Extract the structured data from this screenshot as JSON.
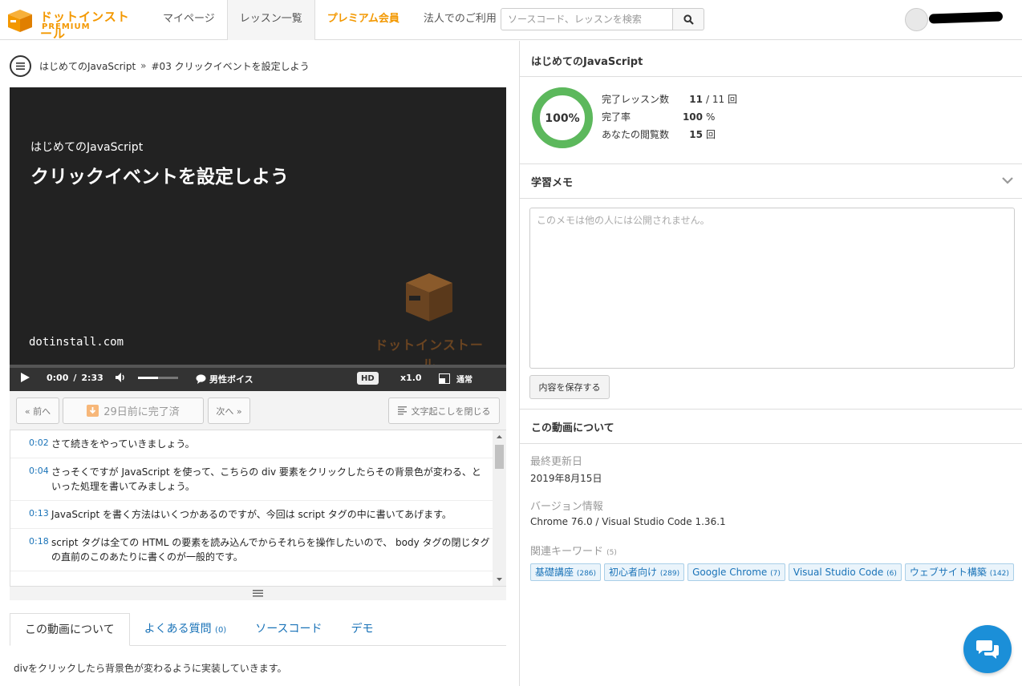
{
  "header": {
    "logo_text": "ドットインストール",
    "logo_sub": "PREMIUM",
    "nav": [
      "マイページ",
      "レッスン一覧",
      "プレミアム会員",
      "法人でのご利用"
    ],
    "search_placeholder": "ソースコード、レッスンを検索"
  },
  "breadcrumb": {
    "course": "はじめてのJavaScript",
    "separator": "»",
    "lesson": "#03 クリックイベントを設定しよう"
  },
  "video": {
    "course": "はじめてのJavaScript",
    "title": "クリックイベントを設定しよう",
    "domain": "dotinstall.com",
    "watermark": "ドットインストール",
    "current_time": "0:00",
    "time_sep": "/",
    "duration": "2:33",
    "voice": "男性ボイス",
    "quality": "HD",
    "speed": "x1.0",
    "mode": "通常",
    "volume_level": 0.5,
    "progress": 0
  },
  "buttons": {
    "prev": "« 前へ",
    "completed": "29日前に完了済",
    "next": "次へ »",
    "close_transcript": "文字起こしを閉じる"
  },
  "transcript": [
    {
      "time": "0:02",
      "text": "さて続きをやっていきましょう。"
    },
    {
      "time": "0:04",
      "text": "さっそくですが JavaScript を使って、こちらの div 要素をクリックしたらその背景色が変わる、といった処理を書いてみましょう。"
    },
    {
      "time": "0:13",
      "text": "JavaScript を書く方法はいくつかあるのですが、今回は script タグの中に書いてあげます。"
    },
    {
      "time": "0:18",
      "text": "script タグは全ての HTML の要素を読み込んでからそれらを操作したいので、 body タグの閉じタグの直前のこのあたりに書くのが一般的です。"
    }
  ],
  "tabs": [
    {
      "label": "この動画について",
      "count": ""
    },
    {
      "label": "よくある質問",
      "count": "(0)"
    },
    {
      "label": "ソースコード",
      "count": ""
    },
    {
      "label": "デモ",
      "count": ""
    }
  ],
  "description": "divをクリックしたら背景色が変わるように実装していきます。",
  "course_panel": {
    "title": "はじめてのJavaScript",
    "percent": "100%",
    "progress_fraction": 1.0,
    "stats": [
      {
        "label": "完了レッスン数",
        "value": "11",
        "unit": "/ 11 回"
      },
      {
        "label": "完了率",
        "value": "100",
        "unit": "%"
      },
      {
        "label": "あなたの閲覧数",
        "value": "15",
        "unit": "回"
      }
    ]
  },
  "memo": {
    "title": "学習メモ",
    "placeholder": "このメモは他の人には公開されません。",
    "save_label": "内容を保存する"
  },
  "about": {
    "title": "この動画について",
    "updated_label": "最終更新日",
    "updated_value": "2019年8月15日",
    "version_label": "バージョン情報",
    "version_value": "Chrome 76.0 / Visual Studio Code 1.36.1",
    "keywords_label": "関連キーワード",
    "keywords_count": "(5)",
    "keywords": [
      {
        "name": "基礎講座",
        "count": "(286)"
      },
      {
        "name": "初心者向け",
        "count": "(289)"
      },
      {
        "name": "Google Chrome",
        "count": "(7)"
      },
      {
        "name": "Visual Studio Code",
        "count": "(6)"
      },
      {
        "name": "ウェブサイト構築",
        "count": "(142)"
      }
    ]
  },
  "colors": {
    "brand": "#f39800",
    "link": "#1a73b8",
    "progress_green": "#5cb85c",
    "chat": "#1b8fd8"
  }
}
